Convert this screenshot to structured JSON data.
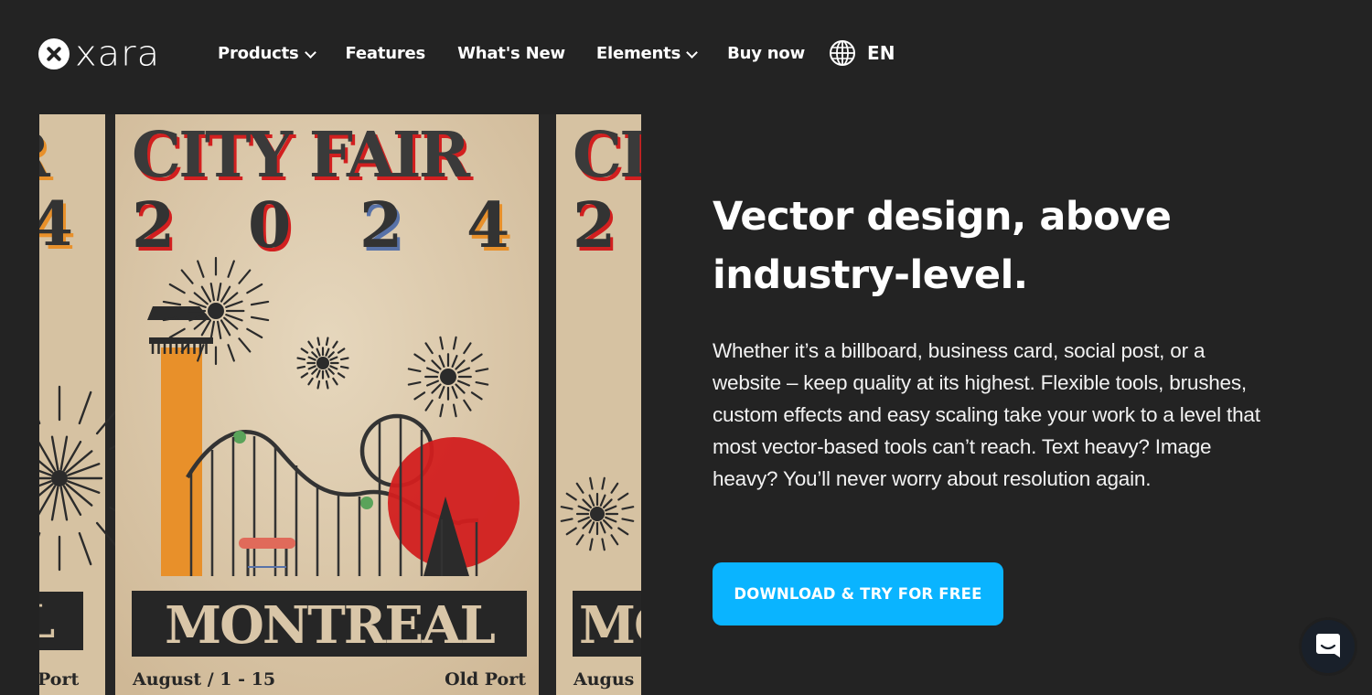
{
  "brand": {
    "logo_text": "xara",
    "logo_icon": "x-circle-icon"
  },
  "nav": {
    "items": [
      {
        "label": "Products",
        "has_dropdown": true
      },
      {
        "label": "Features",
        "has_dropdown": false
      },
      {
        "label": "What's New",
        "has_dropdown": false
      },
      {
        "label": "Elements",
        "has_dropdown": true
      },
      {
        "label": "Buy now",
        "has_dropdown": false
      }
    ],
    "language": {
      "icon": "globe-icon",
      "label": "EN"
    }
  },
  "hero_image": {
    "description": "Retro fair poster repeated in three panels",
    "poster": {
      "title_line1": "CITY FAIR",
      "title_line2": [
        "2",
        "0",
        "2",
        "4"
      ],
      "banner": "MONTREAL",
      "date": "August / 1 - 15",
      "location": "Old Port",
      "left_panel_partial": {
        "title": "R",
        "digit": "4",
        "banner": "L",
        "footer": "Port"
      },
      "right_panel_partial": {
        "title": "CI",
        "digit": "2",
        "banner": "MO",
        "footer": "Augus"
      }
    },
    "colors": {
      "paper": "#d9c6a8",
      "ink": "#2b2b2b",
      "orange": "#e8902a",
      "red": "#d21f1f",
      "green": "#5aa35a",
      "blue": "#5872a8",
      "bench": "#e06a5a"
    }
  },
  "hero": {
    "title": "Vector design, above industry-level.",
    "body": "Whether it’s a billboard, business card, social post, or a website – keep quality at its highest. Flexible tools, brushes, custom effects and easy scaling take your work to a level that most vector-based tools can’t reach. Text heavy? Image heavy? You’ll never worry about resolution again.",
    "cta_label": "DOWNLOAD & TRY FOR FREE",
    "cta_color": "#0ab4ff"
  },
  "chat_widget": {
    "icon": "chat-bubble-icon"
  },
  "theme": {
    "background": "#232323",
    "text": "#ffffff"
  }
}
